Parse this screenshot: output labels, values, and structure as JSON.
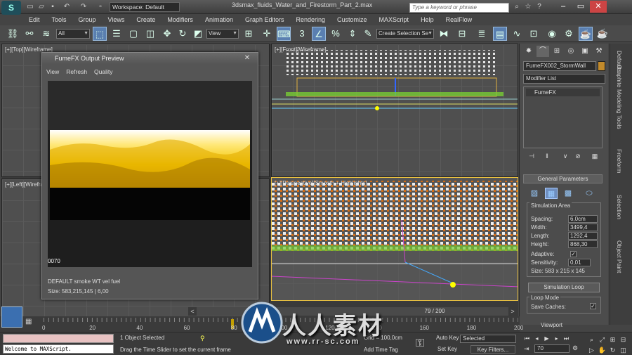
{
  "titlebar": {
    "workspace": "Workspace: Default",
    "window_title": "3dsmax_fluids_Water_and_Firestorm_Part_2.max",
    "search_placeholder": "Type a keyword or phrase"
  },
  "menu": [
    "Edit",
    "Tools",
    "Group",
    "Views",
    "Create",
    "Modifiers",
    "Animation",
    "Graph Editors",
    "Rendering",
    "Customize",
    "MAXScript",
    "Help",
    "RealFlow"
  ],
  "toolbar": {
    "filter": "All",
    "refcoord": "View",
    "selection_set": "Create Selection Se"
  },
  "viewports": {
    "top_left": "[+][Top][Wireframe]",
    "top_right": "[+][Front][Wireframe]",
    "bottom_left": "[+][Left][Wireframe]",
    "bottom_right": "[+][Perspective][Smooth + Highlights]"
  },
  "fume_window": {
    "title": "FumeFX Output Preview",
    "menu": [
      "View",
      "Refresh",
      "Quality"
    ],
    "frame": "0070",
    "status1": "DEFAULT smoke WT vel fuel",
    "status2": "Size: 583,215,145 | 6,00"
  },
  "command_panel": {
    "object_name": "FumeFX002_StormWall",
    "modifier_list": "Modifier List",
    "stack_item": "FumeFX",
    "rollout": "General Parameters",
    "sim_area": "Simulation Area",
    "params": [
      {
        "label": "Spacing:",
        "value": "6,0cm"
      },
      {
        "label": "Width:",
        "value": "3499,4"
      },
      {
        "label": "Length:",
        "value": "1292,4"
      },
      {
        "label": "Height:",
        "value": "868,30"
      }
    ],
    "adaptive": "Adaptive:",
    "sensitivity_label": "Sensitivity:",
    "sensitivity": "0,01",
    "size": "Size:  583 x 215 x 145",
    "sim_loop": "Simulation Loop",
    "loop_mode": "Loop Mode",
    "save_caches": "Save Caches:",
    "viewport": "Viewport"
  },
  "side_tabs": [
    "Graphite Modeling Tools",
    "Freeform",
    "Selection",
    "Object Paint"
  ],
  "side_tab_defaults": "Defaults",
  "timeline": {
    "frame_text": "79 / 200",
    "ticks": [
      "0",
      "20",
      "40",
      "60",
      "80",
      "100",
      "120",
      "140",
      "160",
      "180",
      "200"
    ],
    "current_frame": 79
  },
  "status": {
    "maxscript_out": "Welcome to MAXScript.",
    "selected": "1 Object Selected",
    "prompt": "Drag the Time Slider to set the current frame",
    "grid": "Grid = 100,0cm",
    "add_time_tag": "Add Time Tag",
    "auto_key": "Auto Key",
    "set_key": "Set Key",
    "selected_combo": "Selected",
    "key_filters": "Key Filters...",
    "frame_field": "70"
  },
  "watermark": {
    "text": "人人素材",
    "url": "www.rr-sc.com"
  }
}
